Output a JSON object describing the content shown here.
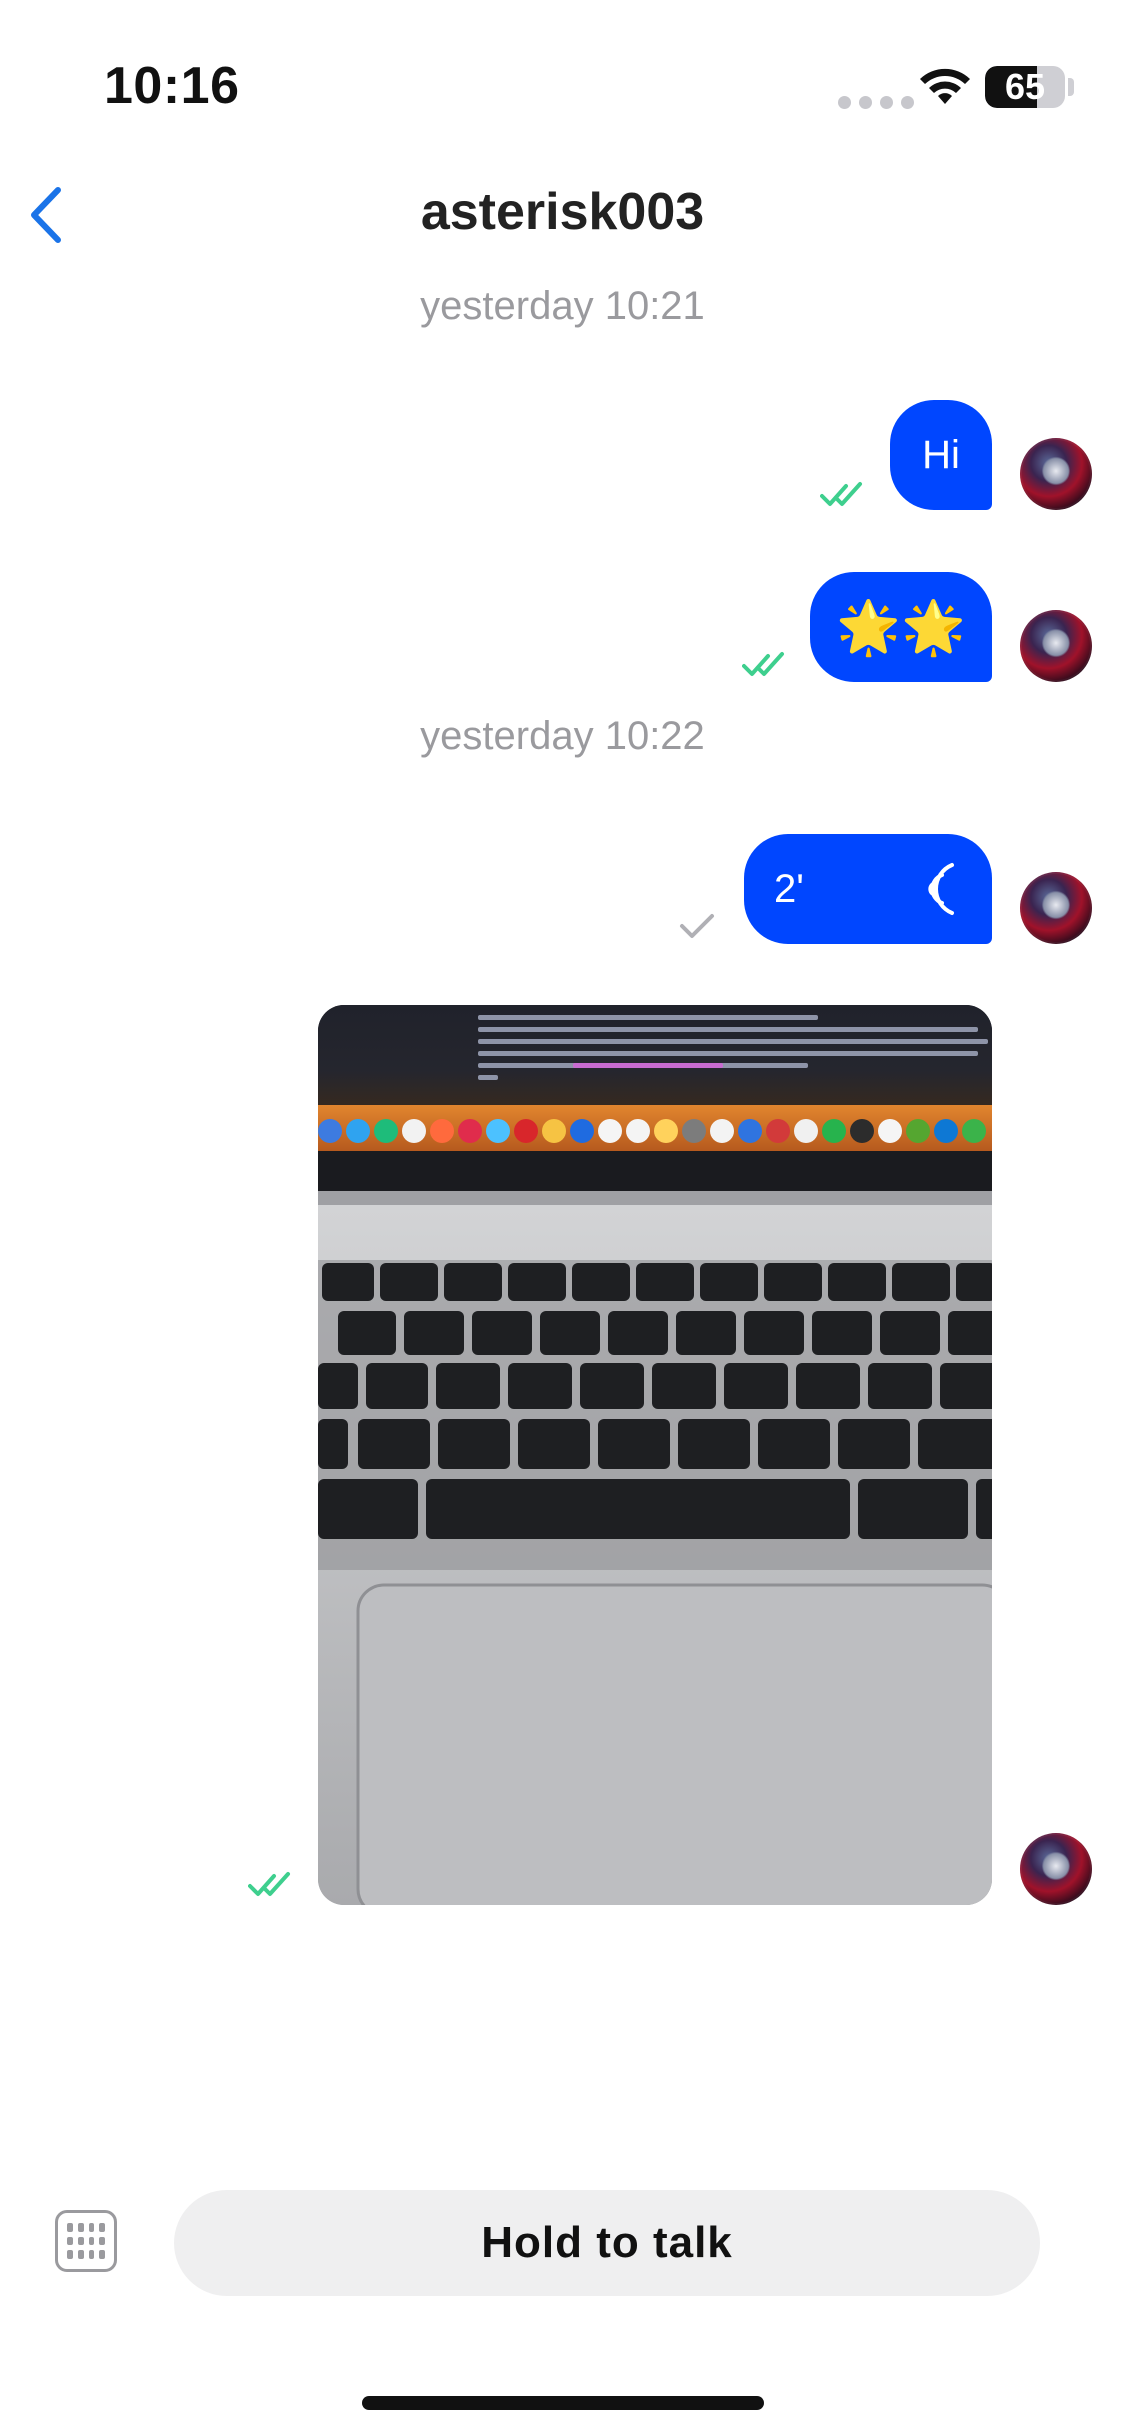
{
  "status_bar": {
    "time": "10:16",
    "battery": "65",
    "battery_level": 0.65
  },
  "header": {
    "title": "asterisk003",
    "back_icon": "chevron-left-icon"
  },
  "timestamps": [
    "yesterday 10:21",
    "yesterday 10:22"
  ],
  "messages": [
    {
      "type": "text",
      "text": "Hi",
      "status": "read"
    },
    {
      "type": "text",
      "text": "🌟🌟",
      "status": "read"
    },
    {
      "type": "voice",
      "duration": "2'",
      "status": "sent"
    },
    {
      "type": "image",
      "status": "read"
    }
  ],
  "composer": {
    "keyboard_icon": "keyboard-icon",
    "hold_to_talk_label": "Hold to talk"
  },
  "colors": {
    "bubble": "#0046ff",
    "read_check": "#3ecf8e",
    "sent_check": "#b0b0b5",
    "accent": "#1a73e8"
  }
}
